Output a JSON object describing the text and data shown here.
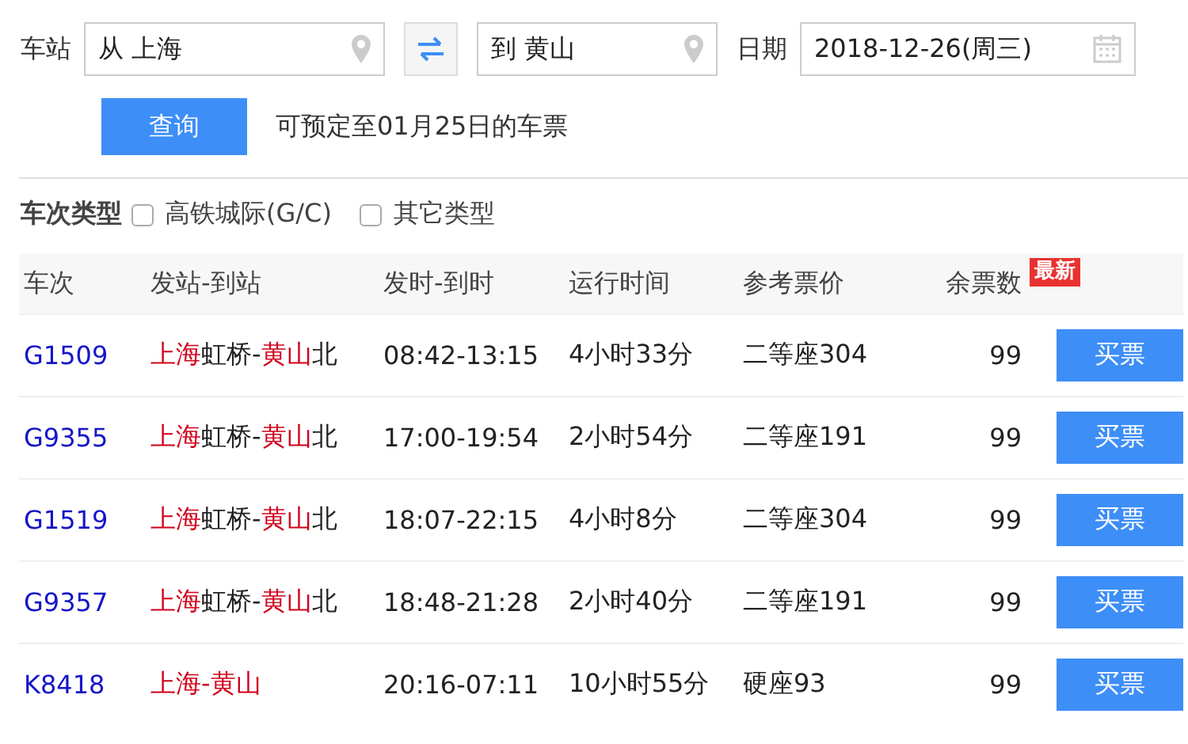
{
  "search": {
    "station_label": "车站",
    "from": "从 上海",
    "to": "到 黄山",
    "date_label": "日期",
    "date": "2018-12-26(周三)",
    "query_button": "查询",
    "notice": "可预定至01月25日的车票"
  },
  "filters": {
    "label": "车次类型",
    "options": [
      {
        "label": "高铁城际(G/C)",
        "checked": false
      },
      {
        "label": "其它类型",
        "checked": false
      }
    ]
  },
  "table": {
    "columns": [
      "车次",
      "发站-到站",
      "发时-到时",
      "运行时间",
      "参考票价",
      "余票数"
    ],
    "badge": "最新",
    "rows": [
      {
        "train": "G1509",
        "route": [
          {
            "text": "上海",
            "highlight": true
          },
          {
            "text": "虹桥-",
            "highlight": false
          },
          {
            "text": "黄山",
            "highlight": true
          },
          {
            "text": "北",
            "highlight": false
          }
        ],
        "times": "08:42-13:15",
        "duration": "4小时33分",
        "price": "二等座304",
        "remaining": "99",
        "button": "买票"
      },
      {
        "train": "G9355",
        "route": [
          {
            "text": "上海",
            "highlight": true
          },
          {
            "text": "虹桥-",
            "highlight": false
          },
          {
            "text": "黄山",
            "highlight": true
          },
          {
            "text": "北",
            "highlight": false
          }
        ],
        "times": "17:00-19:54",
        "duration": "2小时54分",
        "price": "二等座191",
        "remaining": "99",
        "button": "买票"
      },
      {
        "train": "G1519",
        "route": [
          {
            "text": "上海",
            "highlight": true
          },
          {
            "text": "虹桥-",
            "highlight": false
          },
          {
            "text": "黄山",
            "highlight": true
          },
          {
            "text": "北",
            "highlight": false
          }
        ],
        "times": "18:07-22:15",
        "duration": "4小时8分",
        "price": "二等座304",
        "remaining": "99",
        "button": "买票"
      },
      {
        "train": "G9357",
        "route": [
          {
            "text": "上海",
            "highlight": true
          },
          {
            "text": "虹桥-",
            "highlight": false
          },
          {
            "text": "黄山",
            "highlight": true
          },
          {
            "text": "北",
            "highlight": false
          }
        ],
        "times": "18:48-21:28",
        "duration": "2小时40分",
        "price": "二等座191",
        "remaining": "99",
        "button": "买票"
      },
      {
        "train": "K8418",
        "route": [
          {
            "text": "上海-黄山",
            "highlight": true
          }
        ],
        "times": "20:16-07:11",
        "duration": "10小时55分",
        "price": "硬座93",
        "remaining": "99",
        "button": "买票"
      }
    ]
  }
}
